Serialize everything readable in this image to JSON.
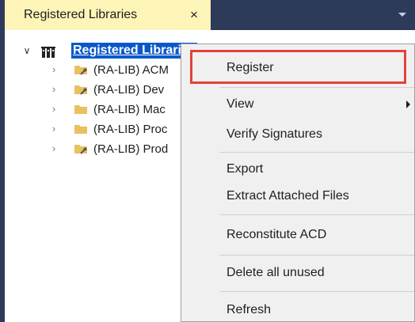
{
  "panel": {
    "tab_title": "Registered Libraries",
    "close_glyph": "×",
    "colors": {
      "chrome": "#2d3a5a",
      "active_tab": "#fdf4b7",
      "selection": "#0a58c8",
      "highlight": "#e0433c"
    }
  },
  "tree": {
    "root": {
      "label": "Registered Libraries",
      "expanded": true,
      "icon": "library-icon"
    },
    "children": [
      {
        "label": "(RA-LIB) ACM",
        "icon": "folder-wrench-icon"
      },
      {
        "label": "(RA-LIB) Dev",
        "icon": "folder-wrench-icon"
      },
      {
        "label": "(RA-LIB) Mac",
        "icon": "folder-icon"
      },
      {
        "label": "(RA-LIB) Proc",
        "icon": "folder-icon"
      },
      {
        "label": "(RA-LIB) Prod",
        "icon": "folder-wrench-icon"
      }
    ]
  },
  "context_menu": {
    "items": [
      {
        "label": "Register",
        "highlighted": true
      },
      {
        "label": "View",
        "has_submenu": true
      },
      {
        "label": "Verify Signatures"
      },
      {
        "label": "Export"
      },
      {
        "label": "Extract Attached Files"
      },
      {
        "label": "Reconstitute ACD"
      },
      {
        "label": "Delete all unused"
      },
      {
        "label": "Refresh"
      }
    ]
  }
}
